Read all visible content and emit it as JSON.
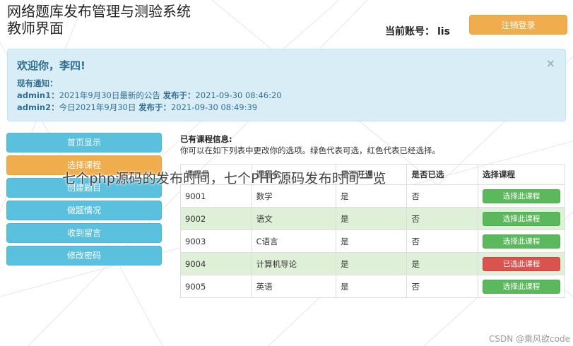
{
  "header": {
    "system_title_line1": "网络题库发布管理与测验系统",
    "system_title_line2": "教师界面",
    "account_label": "当前账号：",
    "account_id": "lis",
    "logout_label": "注销登录"
  },
  "alert": {
    "welcome": "欢迎你，李四!",
    "close_symbol": "×",
    "notice_label": "现有通知：",
    "notices": [
      {
        "user": "admin1：",
        "text": "2021年9月30日最新的公告",
        "publish_label": "发布于：",
        "time": "2021-09-30 08:46:20"
      },
      {
        "user": "admin2：",
        "text": "今日2021年9月30日",
        "publish_label": "发布于：",
        "time": "2021-09-30 08:49:39"
      }
    ]
  },
  "menu": {
    "items": [
      {
        "label": "首页显示"
      },
      {
        "label": "选择课程"
      },
      {
        "label": "创建题目"
      },
      {
        "label": "做题情况"
      },
      {
        "label": "收到留言"
      },
      {
        "label": "修改密码"
      }
    ]
  },
  "courses": {
    "heading": "已有课程信息:",
    "subheading": "你可以在如下列表中更改你的选项。绿色代表可选，红色代表已经选择。",
    "columns": [
      "课程号",
      "课程名",
      "是否开课",
      "是否已选",
      "选择课程"
    ],
    "rows": [
      {
        "id": "9001",
        "name": "数学",
        "open": "是",
        "chosen": "否",
        "action": "选择此课程"
      },
      {
        "id": "9002",
        "name": "语文",
        "open": "是",
        "chosen": "否",
        "action": "选择此课程"
      },
      {
        "id": "9003",
        "name": "C语言",
        "open": "是",
        "chosen": "否",
        "action": "选择此课程"
      },
      {
        "id": "9004",
        "name": "计算机导论",
        "open": "是",
        "chosen": "是",
        "action": "已选此课程"
      },
      {
        "id": "9005",
        "name": "英语",
        "open": "是",
        "chosen": "否",
        "action": "选择此课程"
      }
    ]
  },
  "overlay_text": "七个php源码的发布时间，七个PHP源码发布时间一览",
  "watermark": "CSDN @乘风欲code",
  "colors": {
    "info_blue": "#5bc0de",
    "warning_orange": "#f0ad4e",
    "success_green": "#5cb85c",
    "danger_red": "#d9534f",
    "alert_bg": "#d9edf7",
    "row_success_bg": "#dff0d8"
  }
}
